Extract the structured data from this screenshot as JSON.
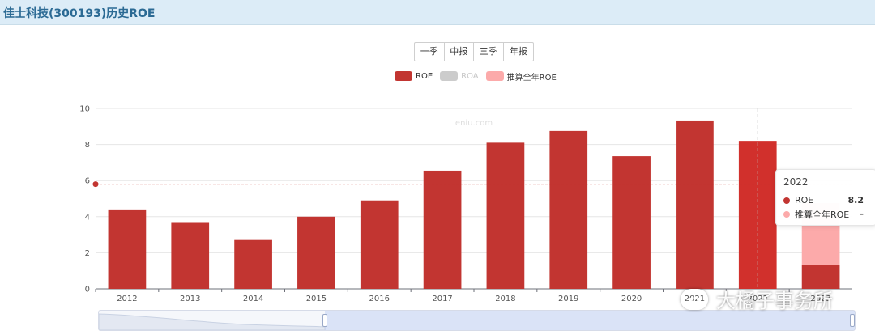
{
  "header": {
    "title": "佳士科技(300193)历史ROE"
  },
  "period_buttons": [
    "一季",
    "中报",
    "三季",
    "年报"
  ],
  "legend": [
    {
      "label": "ROE",
      "color": "#c23531",
      "active": true
    },
    {
      "label": "ROA",
      "color": "#cccccc",
      "active": false
    },
    {
      "label": "推算全年ROE",
      "color": "#fcaaaa",
      "active": true
    }
  ],
  "chart_data": {
    "type": "bar",
    "categories": [
      "2012",
      "2013",
      "2014",
      "2015",
      "2016",
      "2017",
      "2018",
      "2019",
      "2020",
      "2021",
      "2022",
      "2023"
    ],
    "series": [
      {
        "name": "ROE",
        "color": "#c23531",
        "values": [
          4.4,
          3.7,
          2.75,
          4.0,
          4.9,
          6.55,
          8.1,
          8.75,
          7.35,
          9.33,
          8.2,
          1.3
        ]
      },
      {
        "name": "推算全年ROE",
        "color": "#fcaaaa",
        "values": [
          null,
          null,
          null,
          null,
          null,
          null,
          null,
          null,
          null,
          null,
          null,
          4.75
        ]
      }
    ],
    "ylim": [
      0,
      10
    ],
    "yticks": [
      0,
      2,
      4,
      6,
      8,
      10
    ],
    "average_line": 5.8,
    "highlight_category": "2022",
    "grid": true
  },
  "tooltip": {
    "title": "2022",
    "rows": [
      {
        "name": "ROE",
        "value": "8.2",
        "color": "#c23531"
      },
      {
        "name": "推算全年ROE",
        "value": "-",
        "color": "#fcaaaa"
      }
    ]
  },
  "chart_watermark": "eniu.com",
  "watermark": "大橘子事务所"
}
